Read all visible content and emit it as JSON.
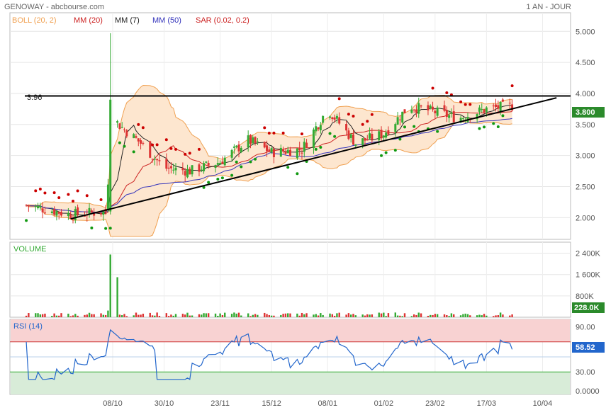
{
  "header": {
    "title": "GENOWAY - abcbourse.com",
    "period": "1 AN - JOUR"
  },
  "legend": [
    {
      "label": "BOLL (20, 2)",
      "color": "#f0a050"
    },
    {
      "label": "MM (20)",
      "color": "#cc2222"
    },
    {
      "label": "MM (7)",
      "color": "#222222"
    },
    {
      "label": "MM (50)",
      "color": "#3333bb"
    },
    {
      "label": "SAR (0.02, 0.2)",
      "color": "#cc2222"
    }
  ],
  "panels": {
    "volume_label": "VOLUME",
    "rsi_label": "RSI (14)"
  },
  "colors": {
    "up": "#33aa33",
    "down": "#dd3333",
    "bollinger_fill": "#fde6cf",
    "bollinger_line": "#f0a050",
    "sar_bull": "#119911",
    "sar_bear": "#cc0000",
    "rsi_line": "#2266cc",
    "rsi_high_zone": "#f8d2d2",
    "rsi_low_zone": "#d8ecd8"
  },
  "chart_data": {
    "type": "candlestick",
    "x_tick_labels": [
      "08/10",
      "30/10",
      "23/11",
      "15/12",
      "08/01",
      "01/02",
      "23/02",
      "17/03",
      "10/04"
    ],
    "price": {
      "y_ticks": [
        "5.000",
        "4.500",
        "4.000",
        "3.500",
        "3.000",
        "2.500",
        "2.000"
      ],
      "ylim": [
        1.65,
        5.3
      ],
      "resistance_label": "3.96",
      "resistance_level": 3.96,
      "trendline": {
        "start": [
          "2022-09-20",
          1.98
        ],
        "end": [
          "2023-04-16",
          3.93
        ]
      },
      "last_price": "3.800",
      "approx_close_points": [
        [
          "2022-09-01",
          2.2
        ],
        [
          "2022-09-20",
          2.05
        ],
        [
          "2022-10-05",
          2.1
        ],
        [
          "2022-10-08",
          3.6
        ],
        [
          "2022-10-12",
          3.45
        ],
        [
          "2022-10-20",
          3.2
        ],
        [
          "2022-10-30",
          2.8
        ],
        [
          "2022-11-10",
          2.75
        ],
        [
          "2022-11-23",
          2.9
        ],
        [
          "2022-12-05",
          3.25
        ],
        [
          "2022-12-15",
          3.05
        ],
        [
          "2022-12-28",
          3.1
        ],
        [
          "2023-01-08",
          3.75
        ],
        [
          "2023-01-20",
          3.2
        ],
        [
          "2023-02-01",
          3.35
        ],
        [
          "2023-02-12",
          3.8
        ],
        [
          "2023-02-23",
          3.7
        ],
        [
          "2023-03-05",
          3.6
        ],
        [
          "2023-03-17",
          3.75
        ],
        [
          "2023-03-28",
          3.8
        ]
      ]
    },
    "volume": {
      "y_ticks": [
        "2 400K",
        "1 600K",
        "800K"
      ],
      "ymax": 2600,
      "last_volume": "228.0K",
      "spike_date": "2022-10-08",
      "spike_value_k": 2350
    },
    "rsi": {
      "y_ticks": [
        "90.00",
        "30.00",
        "0.0000"
      ],
      "ylim": [
        0,
        100
      ],
      "upper_level": 70,
      "lower_level": 30,
      "last_value": "58.52"
    }
  }
}
